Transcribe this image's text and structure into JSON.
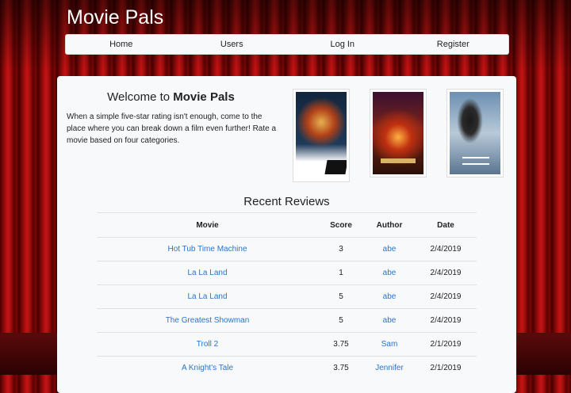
{
  "brand": "Movie Pals",
  "nav": [
    "Home",
    "Users",
    "Log In",
    "Register"
  ],
  "welcome": {
    "title_prefix": "Welcome to ",
    "title_bold": "Movie Pals",
    "text": "When a simple five-star rating isn't enough, come to the place where you can break down a film even further! Rate a movie based on four categories."
  },
  "posters": [
    "star-wars-poster",
    "avengers-infinity-war-poster",
    "casino-royale-poster"
  ],
  "reviews": {
    "title": "Recent Reviews",
    "headers": [
      "Movie",
      "Score",
      "Author",
      "Date"
    ],
    "rows": [
      {
        "movie": "Hot Tub Time Machine",
        "score": "3",
        "author": "abe",
        "date": "2/4/2019"
      },
      {
        "movie": "La La Land",
        "score": "1",
        "author": "abe",
        "date": "2/4/2019"
      },
      {
        "movie": "La La Land",
        "score": "5",
        "author": "abe",
        "date": "2/4/2019"
      },
      {
        "movie": "The Greatest Showman",
        "score": "5",
        "author": "abe",
        "date": "2/4/2019"
      },
      {
        "movie": "Troll 2",
        "score": "3.75",
        "author": "Sam",
        "date": "2/1/2019"
      },
      {
        "movie": "A Knight's Tale",
        "score": "3.75",
        "author": "Jennifer",
        "date": "2/1/2019"
      }
    ]
  },
  "colors": {
    "link": "#2a74c9",
    "curtain": "#c41414",
    "panel": "#f8f9fa"
  }
}
